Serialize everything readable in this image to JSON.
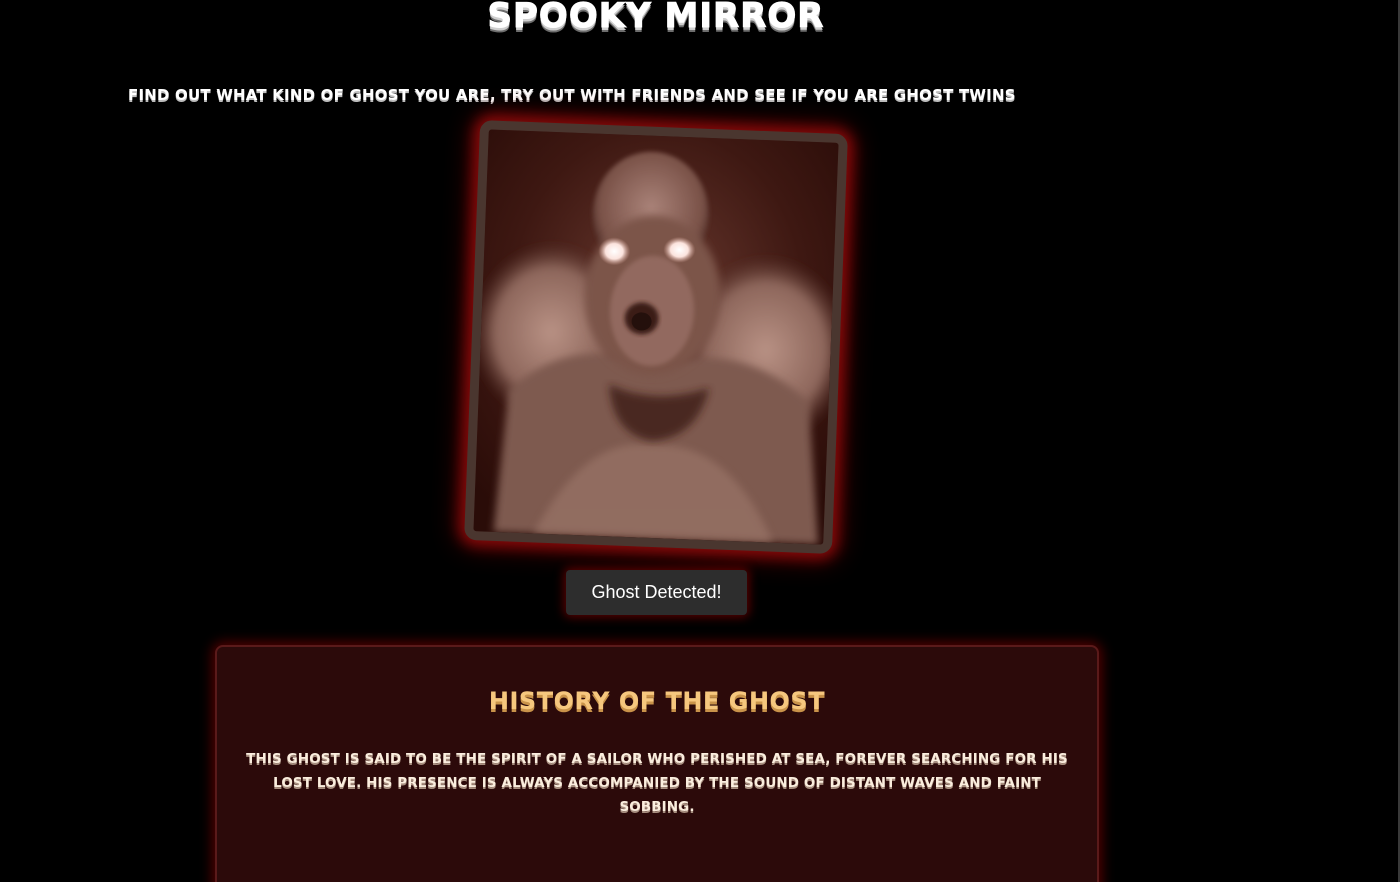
{
  "header": {
    "title": "SPOOKY MIRROR",
    "subtitle": "FIND OUT WHAT KIND OF GHOST YOU ARE, TRY OUT WITH FRIENDS AND SEE IF YOU ARE GHOST TWINS"
  },
  "mirror": {
    "frame_color": "#4a362f",
    "glow_color": "#8a0a0a"
  },
  "detect_button": {
    "label": "Ghost Detected!"
  },
  "history": {
    "title": "HISTORY OF THE GHOST",
    "text": "THIS GHOST IS SAID TO BE THE SPIRIT OF A SAILOR WHO PERISHED AT SEA, FOREVER SEARCHING FOR HIS LOST LOVE. HIS PRESENCE IS ALWAYS ACCOMPANIED BY THE SOUND OF DISTANT WAVES AND FAINT SOBBING.",
    "title_color": "#f6c77e",
    "panel_color": "#2c0a0a"
  }
}
